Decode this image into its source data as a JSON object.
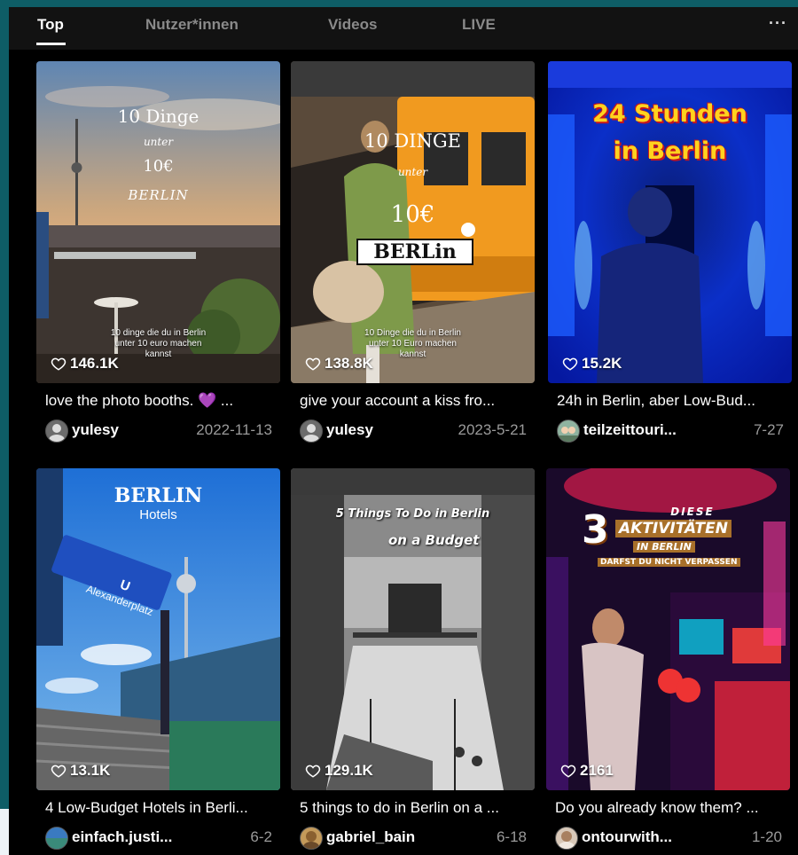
{
  "tabs": [
    "Top",
    "Nutzer*innen",
    "Videos",
    "LIVE"
  ],
  "more_label": "···",
  "videos": [
    {
      "likes": "146.1K",
      "caption": "love the photo booths. 💜 ...",
      "author": "yulesy",
      "date": "2022-11-13",
      "overlay": [
        "10 Dinge",
        "unter",
        "10€",
        "BERLIN"
      ],
      "subtitle": [
        "10 dinge die du in Berlin",
        "unter 10 euro machen",
        "kannst"
      ]
    },
    {
      "likes": "138.8K",
      "caption": "give your account a kiss fro...",
      "author": "yulesy",
      "date": "2023-5-21",
      "overlay": [
        "10 DINGE",
        "unter",
        "10€",
        "BERLin"
      ],
      "subtitle": [
        "10 Dinge die du in Berlin",
        "unter 10 Euro machen",
        "kannst"
      ]
    },
    {
      "likes": "15.2K",
      "caption": "24h in Berlin, aber Low-Bud...",
      "author": "teilzeittouri...",
      "date": "7-27",
      "overlay": [
        "24 Stunden",
        "in Berlin"
      ]
    },
    {
      "likes": "13.1K",
      "caption": "4 Low-Budget Hotels in Berli...",
      "author": "einfach.justi...",
      "date": "6-2",
      "overlay": [
        "BERLIN",
        "Hotels"
      ],
      "sign": [
        "U",
        "Alexanderplatz"
      ]
    },
    {
      "likes": "129.1K",
      "caption": "5 things to do in Berlin on a ...",
      "author": "gabriel_bain",
      "date": "6-18",
      "overlay": [
        "5 Things To Do in Berlin",
        "on a Budget"
      ]
    },
    {
      "likes": "2161",
      "caption": "Do you already know them? ...",
      "author": "ontourwith...",
      "date": "1-20",
      "overlay": [
        "DIESE",
        "3",
        "AKTIVITÄTEN",
        "IN BERLIN",
        "DARFST DU NICHT VERPASSEN"
      ]
    }
  ]
}
